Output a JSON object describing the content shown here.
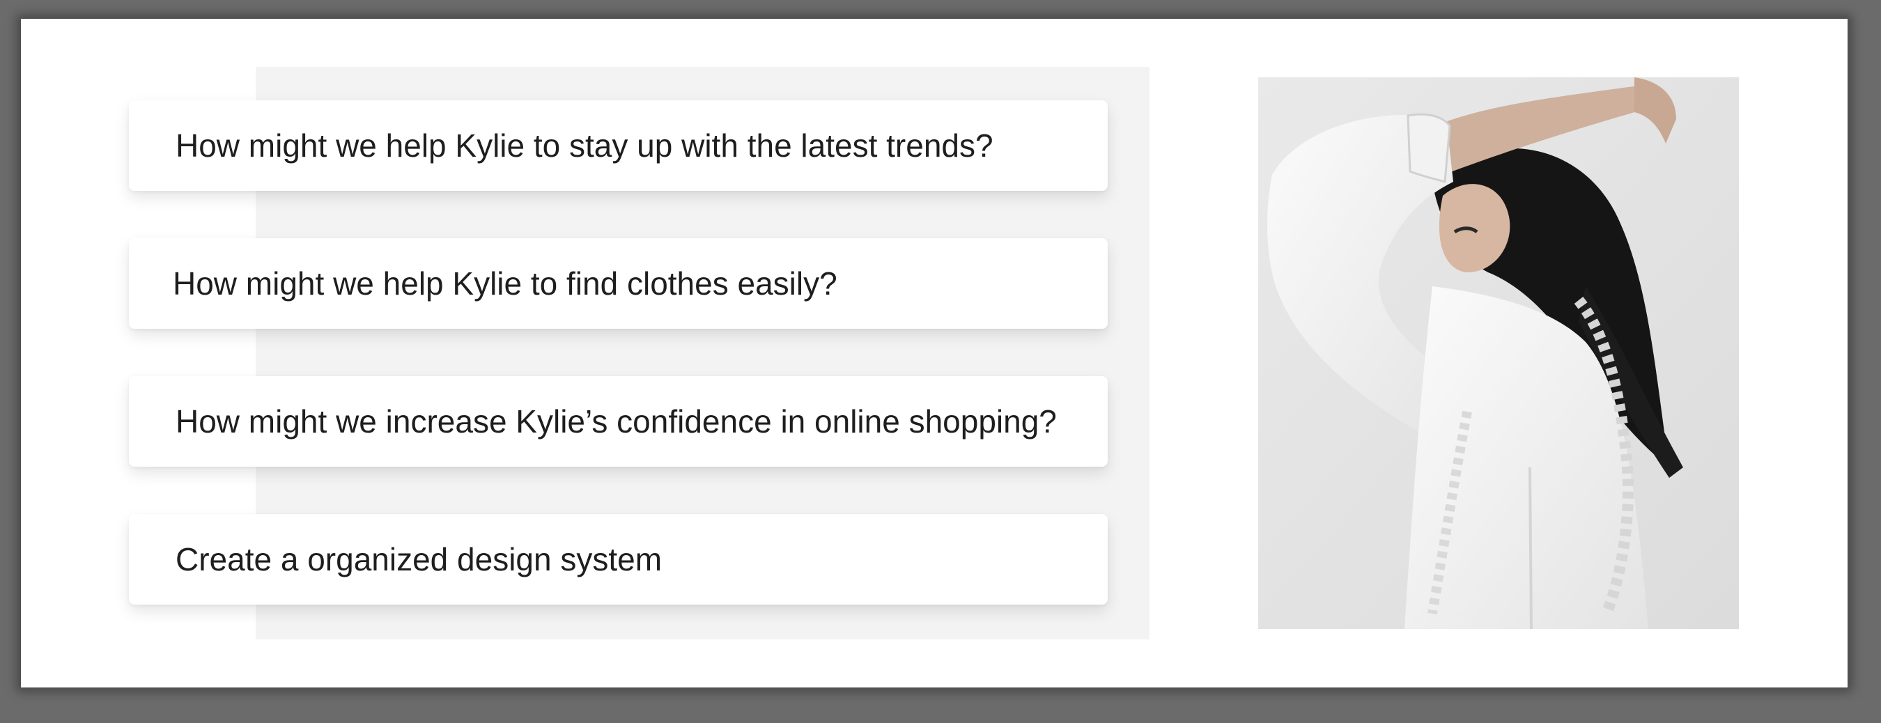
{
  "cards": [
    {
      "text": "How might we help Kylie to stay up with the latest trends?"
    },
    {
      "text": "How might we help Kylie to find clothes easily?"
    },
    {
      "text": "How might we increase Kylie’s confidence in online shopping?"
    },
    {
      "text": "Create a organized design system"
    }
  ],
  "photo": {
    "icon": "portrait-photo"
  }
}
